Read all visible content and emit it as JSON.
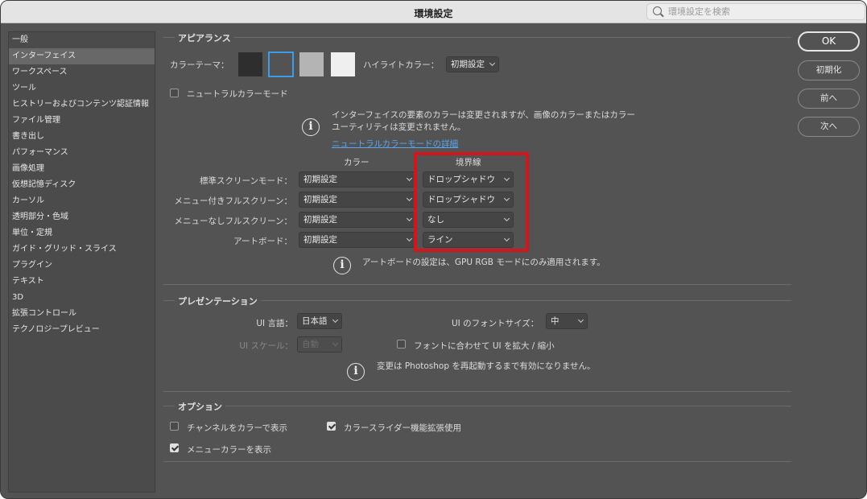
{
  "window": {
    "title": "環境設定"
  },
  "search": {
    "placeholder": "環境設定を検索"
  },
  "sidebar": {
    "items": [
      {
        "label": "一般"
      },
      {
        "label": "インターフェイス"
      },
      {
        "label": "ワークスペース"
      },
      {
        "label": "ツール"
      },
      {
        "label": "ヒストリーおよびコンテンツ認証情報"
      },
      {
        "label": "ファイル管理"
      },
      {
        "label": "書き出し"
      },
      {
        "label": "パフォーマンス"
      },
      {
        "label": "画像処理"
      },
      {
        "label": "仮想記憶ディスク"
      },
      {
        "label": "カーソル"
      },
      {
        "label": "透明部分・色域"
      },
      {
        "label": "単位・定規"
      },
      {
        "label": "ガイド・グリッド・スライス"
      },
      {
        "label": "プラグイン"
      },
      {
        "label": "テキスト"
      },
      {
        "label": "3D"
      },
      {
        "label": "拡張コントロール"
      },
      {
        "label": "テクノロジープレビュー"
      }
    ],
    "selected": "インターフェイス"
  },
  "appearance": {
    "title": "アピアランス",
    "color_theme_label": "カラーテーマ：",
    "themes": [
      "#2e2e2e",
      "#535353",
      "#b4b4b4",
      "#efefef"
    ],
    "selected_theme_accent": "#3d9be9",
    "highlight_label": "ハイライトカラー：",
    "highlight_value": "初期設定",
    "neutral_mode_label": "ニュートラルカラーモード",
    "neutral_mode_checked": false,
    "info_line1": "インターフェイスの要素のカラーは変更されますが、画像のカラーまたはカラー",
    "info_line2": "ユーティリティは変更されません。",
    "info_link": "ニュートラルカラーモードの詳細",
    "col_color": "カラー",
    "col_border": "境界線",
    "rows": [
      {
        "label": "標準スクリーンモード：",
        "color": "初期設定",
        "border": "ドロップシャドウ"
      },
      {
        "label": "メニュー付きフルスクリーン：",
        "color": "初期設定",
        "border": "ドロップシャドウ"
      },
      {
        "label": "メニューなしフルスクリーン：",
        "color": "初期設定",
        "border": "なし"
      },
      {
        "label": "アートボード：",
        "color": "初期設定",
        "border": "ライン"
      }
    ],
    "artboard_note": "アートボードの設定は、GPU RGB モードにのみ適用されます。"
  },
  "presentation": {
    "title": "プレゼンテーション",
    "ui_language_label": "UI 言語：",
    "ui_language_value": "日本語",
    "ui_font_size_label": "UI のフォントサイズ：",
    "ui_font_size_value": "中",
    "ui_scale_label": "UI スケール：",
    "ui_scale_value": "自動",
    "scale_to_font_label": "フォントに合わせて UI を拡大 / 縮小",
    "scale_to_font_checked": false,
    "restart_note": "変更は Photoshop を再起動するまで有効になりません。"
  },
  "options": {
    "title": "オプション",
    "channels_in_color_label": "チャンネルをカラーで表示",
    "channels_in_color_checked": false,
    "dynamic_sliders_label": "カラースライダー機能拡張使用",
    "dynamic_sliders_checked": true,
    "menu_colors_label": "メニューカラーを表示",
    "menu_colors_checked": true
  },
  "buttons": {
    "ok": "OK",
    "reset": "初期化",
    "prev": "前へ",
    "next": "次へ"
  },
  "colors": {
    "window_bg": "#535353",
    "highlight_box": "#d2161b",
    "link": "#5aa6f0"
  }
}
